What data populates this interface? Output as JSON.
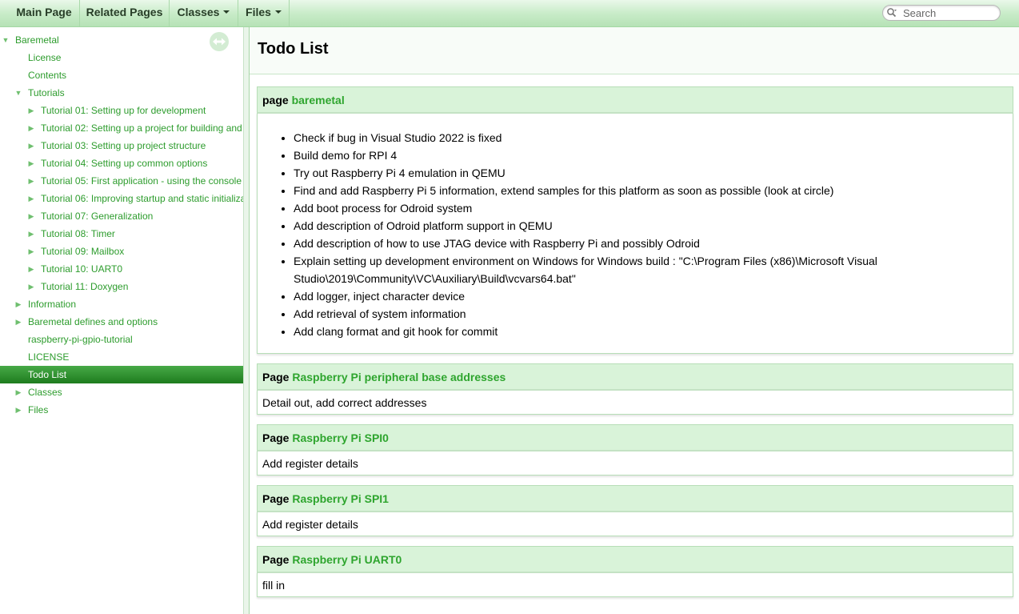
{
  "menu": {
    "main_page": "Main Page",
    "related_pages": "Related Pages",
    "classes": "Classes",
    "files": "Files",
    "search_placeholder": "Search"
  },
  "nav": [
    {
      "label": "Baremetal",
      "expanded": true
    },
    {
      "label": "License"
    },
    {
      "label": "Contents"
    },
    {
      "label": "Tutorials",
      "expanded": true
    },
    {
      "label": "Tutorial 01: Setting up for development"
    },
    {
      "label": "Tutorial 02: Setting up a project for building and"
    },
    {
      "label": "Tutorial 03: Setting up project structure"
    },
    {
      "label": "Tutorial 04: Setting up common options"
    },
    {
      "label": "Tutorial 05: First application - using the console"
    },
    {
      "label": "Tutorial 06: Improving startup and static initializa"
    },
    {
      "label": "Tutorial 07: Generalization"
    },
    {
      "label": "Tutorial 08: Timer"
    },
    {
      "label": "Tutorial 09: Mailbox"
    },
    {
      "label": "Tutorial 10: UART0"
    },
    {
      "label": "Tutorial 11: Doxygen"
    },
    {
      "label": "Information"
    },
    {
      "label": "Baremetal defines and options"
    },
    {
      "label": "raspberry-pi-gpio-tutorial"
    },
    {
      "label": "LICENSE"
    },
    {
      "label": "Todo List",
      "selected": true
    },
    {
      "label": "Classes"
    },
    {
      "label": "Files"
    }
  ],
  "page_title": "Todo List",
  "sections": [
    {
      "kind": "page",
      "link": "baremetal",
      "items": [
        "Check if bug in Visual Studio 2022 is fixed",
        "Build demo for RPI 4",
        "Try out Raspberry Pi 4 emulation in QEMU",
        "Find and add Raspberry Pi 5 information, extend samples for this platform as soon as possible (look at circle)",
        "Add boot process for Odroid system",
        "Add description of Odroid platform support in QEMU",
        "Add description of how to use JTAG device with Raspberry Pi and possibly Odroid",
        "Explain setting up development environment on Windows for Windows build : \"C:\\Program Files (x86)\\Microsoft Visual Studio\\2019\\Community\\VC\\Auxiliary\\Build\\vcvars64.bat\"",
        "Add logger, inject character device",
        "Add retrieval of system information",
        "Add clang format and git hook for commit"
      ]
    },
    {
      "kind": "Page",
      "link": "Raspberry Pi peripheral base addresses",
      "text": "Detail out, add correct addresses"
    },
    {
      "kind": "Page",
      "link": "Raspberry Pi SPI0",
      "text": "Add register details"
    },
    {
      "kind": "Page",
      "link": "Raspberry Pi SPI1",
      "text": "Add register details"
    },
    {
      "kind": "Page",
      "link": "Raspberry Pi UART0",
      "text": "fill in"
    }
  ]
}
